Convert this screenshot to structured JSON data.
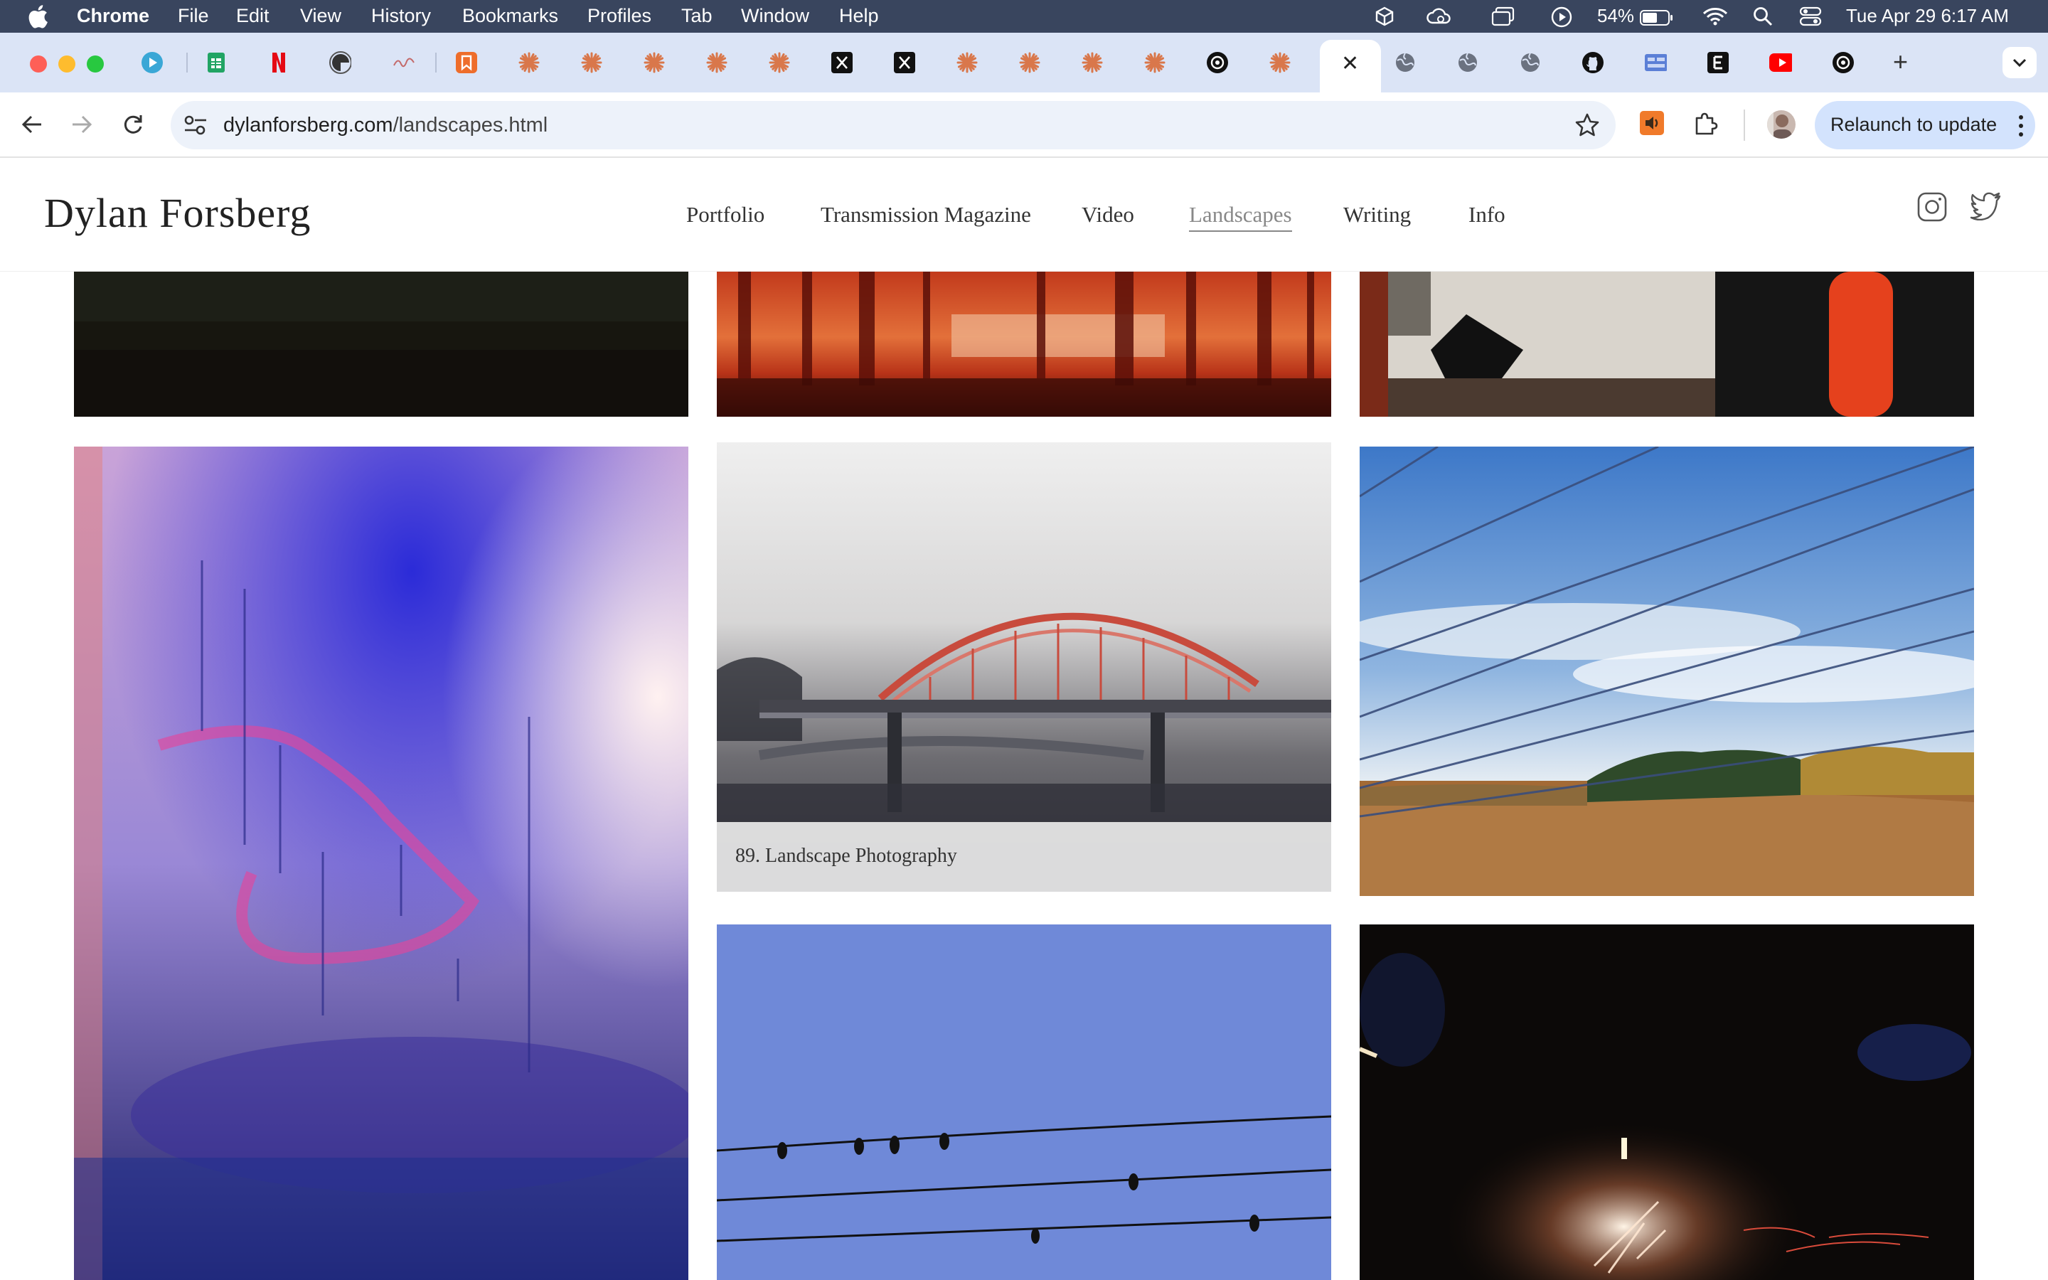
{
  "menubar": {
    "app": "Chrome",
    "items": [
      "File",
      "Edit",
      "View",
      "History",
      "Bookmarks",
      "Profiles",
      "Tab",
      "Window",
      "Help"
    ],
    "battery": "54%",
    "datetime": "Tue Apr 29  6:17 AM"
  },
  "browser": {
    "url_domain": "dylanforsberg.com",
    "url_path": "/landscapes.html",
    "relaunch_label": "Relaunch to update",
    "active_tab_close": "✕",
    "new_tab": "+"
  },
  "site": {
    "logo": "Dylan Forsberg",
    "nav": [
      "Portfolio",
      "Transmission Magazine",
      "Video",
      "Landscapes",
      "Writing",
      "Info"
    ],
    "active_nav": "Landscapes"
  },
  "gallery": {
    "caption": "89. Landscape Photography"
  },
  "colors": {
    "menubar_bg": "#39455e",
    "tabstrip_bg": "#dbe4f6",
    "omnibox_bg": "#edf2fa",
    "relaunch_bg": "#d3e3fd"
  }
}
